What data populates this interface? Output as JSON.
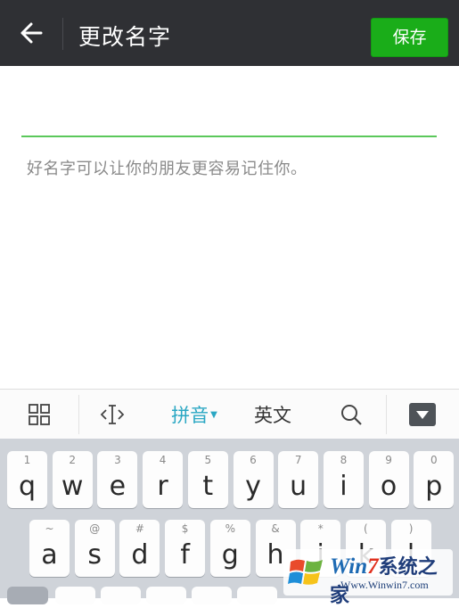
{
  "header": {
    "back_icon": "arrow-left-icon",
    "title": "更改名字",
    "save_label": "保存",
    "colors": {
      "bar": "#2f3034",
      "save": "#1aad19"
    }
  },
  "form": {
    "name_value": "",
    "hint": "好名字可以让你的朋友更容易记住你。",
    "underline_color": "#5bc85b"
  },
  "keyboard_toolbar": {
    "grid_icon": "grid-icon",
    "cursor_icon": "text-cursor-icon",
    "pinyin_label": "拼音",
    "english_label": "英文",
    "search_icon": "search-icon",
    "collapse_icon": "keyboard-hide-icon",
    "active_color": "#2aa7c3"
  },
  "keyboard": {
    "row1": [
      {
        "key": "q",
        "sub": "1"
      },
      {
        "key": "w",
        "sub": "2"
      },
      {
        "key": "e",
        "sub": "3"
      },
      {
        "key": "r",
        "sub": "4"
      },
      {
        "key": "t",
        "sub": "5"
      },
      {
        "key": "y",
        "sub": "6"
      },
      {
        "key": "u",
        "sub": "7"
      },
      {
        "key": "i",
        "sub": "8"
      },
      {
        "key": "o",
        "sub": "9"
      },
      {
        "key": "p",
        "sub": "0"
      }
    ],
    "row2": [
      {
        "key": "a",
        "sub": "~"
      },
      {
        "key": "s",
        "sub": "@"
      },
      {
        "key": "d",
        "sub": "#"
      },
      {
        "key": "f",
        "sub": "$"
      },
      {
        "key": "g",
        "sub": "%"
      },
      {
        "key": "h",
        "sub": "&"
      },
      {
        "key": "j",
        "sub": "*"
      },
      {
        "key": "k",
        "sub": "("
      },
      {
        "key": "l",
        "sub": ")"
      }
    ]
  },
  "watermark": {
    "brand_win": "Win",
    "brand_seven": "7",
    "brand_cn": "系统之家",
    "url": "Www.Winwin7.com"
  }
}
